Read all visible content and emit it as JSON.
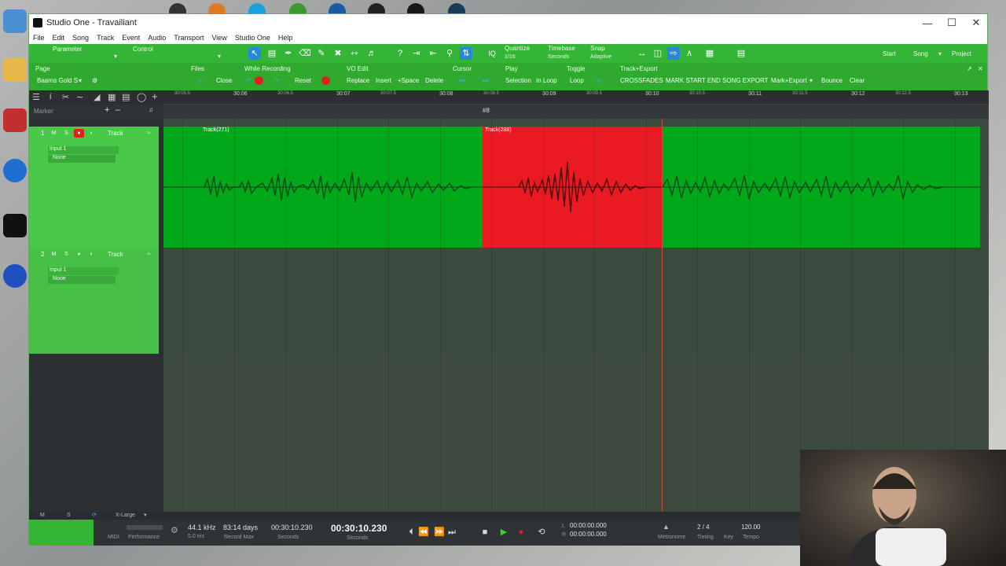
{
  "window": {
    "title": "Studio One - Travailiant"
  },
  "menu": [
    "File",
    "Edit",
    "Song",
    "Track",
    "Event",
    "Audio",
    "Transport",
    "View",
    "Studio One",
    "Help"
  ],
  "toolbar": {
    "parameter": "Parameter",
    "control": "Control",
    "quantize_label": "Quantize",
    "quantize_value": "1/16",
    "timebase_label": "Timebase",
    "timebase_value": "Seconds",
    "snap_label": "Snap",
    "snap_value": "Adaptive",
    "start": "Start",
    "song": "Song",
    "project": "Project"
  },
  "macrobar": {
    "page": "Page",
    "page_value": "Baarns Gold S",
    "files": "Files",
    "close": "Close",
    "while_recording": "While Recording",
    "reset": "Reset",
    "vo_edit": "VO Edit",
    "replace": "Replace",
    "insert": "Insert",
    "space": "+Space",
    "delete": "Delete",
    "cursor": "Cursor",
    "play": "Play",
    "selection": "Selection",
    "in_loop": "In Loop",
    "toggle": "Toggle",
    "loop": "Loop",
    "track_export": "Track+Export",
    "crossfades": "CROSSFADES",
    "mark_start_end": "MARK START END",
    "song_export": "SONG EXPORT",
    "mark_export": "Mark+Export",
    "bounce": "Bounce",
    "clear": "Clear"
  },
  "ruler": {
    "major": [
      "30:06",
      "30:07",
      "30:08",
      "30:09",
      "30:10",
      "30:11",
      "30:12",
      "30:13"
    ],
    "minor": [
      "30:05.5",
      "30:06.5",
      "30:07.5",
      "30:08.5",
      "30:09.5",
      "30:10.5",
      "30:11.5",
      "30:12.5"
    ]
  },
  "marker_label": "Marker",
  "tracks": [
    {
      "num": "1",
      "name": "Track",
      "input": "Input 1",
      "output": "None",
      "armed": true
    },
    {
      "num": "2",
      "name": "Track",
      "input": "Input 1",
      "output": "None",
      "armed": false
    }
  ],
  "clips": {
    "clip1": "Track(271)",
    "clip2": "Track(288)"
  },
  "statusbar": {
    "m": "M",
    "s": "S",
    "size": "X-Large"
  },
  "transport": {
    "midi": "MIDI",
    "performance": "Performance",
    "sample_rate": "44.1 kHz",
    "latency": "5.0 ms",
    "record_max_value": "83:14 days",
    "record_max_label": "Record Max",
    "seconds_small": "00:30:10.230",
    "seconds_label": "Seconds",
    "time_big": "00:30:10.230",
    "time_big_label": "Seconds",
    "l_time": "00:00:00.000",
    "r_time": "00:00:00.000",
    "metronome": "Metronome",
    "timing": "Timing",
    "signature": "2 / 4",
    "key": "Key",
    "tempo_value": "120.00",
    "tempo_label": "Tempo",
    "l_label": "L",
    "r_label": "R"
  },
  "colors": {
    "accent_green": "#35b535",
    "record_red": "#e02020",
    "clip_green": "#00a81a",
    "clip_red": "#ea1a22"
  }
}
